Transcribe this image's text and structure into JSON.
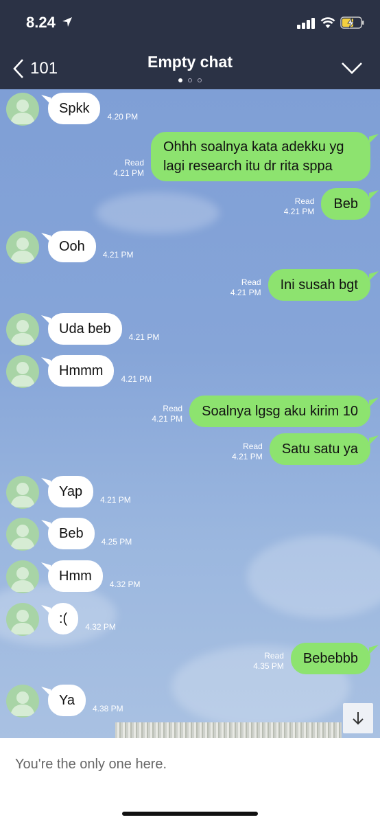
{
  "status_bar": {
    "time": "8.24"
  },
  "nav": {
    "back_count": "101",
    "title": "Empty chat",
    "page_dots": 3,
    "active_dot": 0
  },
  "messages": [
    {
      "side": "in",
      "text": "Spkk",
      "time": "4.20 PM"
    },
    {
      "side": "out",
      "text": "Ohhh soalnya kata adekku yg lagi research itu dr rita sppa",
      "status": "Read",
      "time": "4.21 PM"
    },
    {
      "side": "out",
      "text": "Beb",
      "status": "Read",
      "time": "4.21 PM"
    },
    {
      "side": "in",
      "text": "Ooh",
      "time": "4.21 PM"
    },
    {
      "side": "out",
      "text": "Ini susah bgt",
      "status": "Read",
      "time": "4.21 PM"
    },
    {
      "side": "in",
      "text": "Uda beb",
      "time": "4.21 PM"
    },
    {
      "side": "in",
      "text": "Hmmm",
      "time": "4.21 PM"
    },
    {
      "side": "out",
      "text": "Soalnya lgsg aku kirim 10",
      "status": "Read",
      "time": "4.21 PM"
    },
    {
      "side": "out",
      "text": "Satu satu ya",
      "status": "Read",
      "time": "4.21 PM"
    },
    {
      "side": "in",
      "text": "Yap",
      "time": "4.21 PM"
    },
    {
      "side": "in",
      "text": "Beb",
      "time": "4.25 PM"
    },
    {
      "side": "in",
      "text": "Hmm",
      "time": "4.32 PM"
    },
    {
      "side": "in",
      "text": ":(",
      "time": "4.32 PM"
    },
    {
      "side": "out",
      "text": "Bebebbb",
      "status": "Read",
      "time": "4.35 PM"
    },
    {
      "side": "in",
      "text": "Ya",
      "time": "4.38 PM"
    }
  ],
  "footer": {
    "text": "You're the only one here."
  },
  "colors": {
    "header": "#2b3245",
    "bubble_out": "#8de36f",
    "bubble_in": "#ffffff",
    "chat_bg": "#86a5d8"
  },
  "icons": [
    "location-arrow-icon",
    "signal-icon",
    "wifi-icon",
    "battery-charging-icon",
    "back-chevron-icon",
    "chevron-down-icon",
    "avatar-icon",
    "arrow-down-icon"
  ]
}
